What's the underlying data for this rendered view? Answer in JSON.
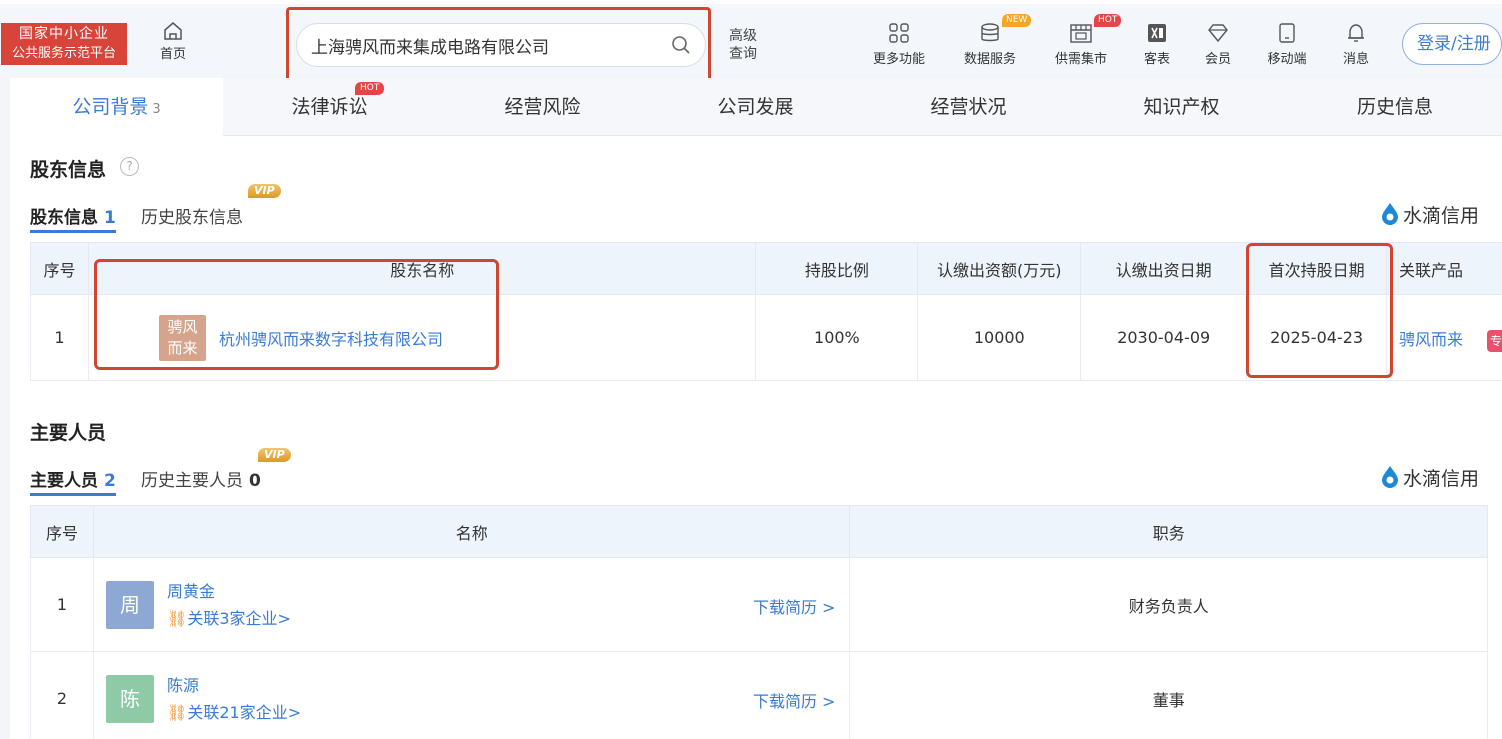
{
  "header": {
    "logo_line1": "国家中小企业",
    "logo_line2": "公共服务示范平台",
    "home_label": "首页",
    "search_value": "上海骋风而来集成电路有限公司",
    "advanced_line1": "高级",
    "advanced_line2": "查询",
    "nav": [
      {
        "label": "更多功能",
        "icon": "grid-icon"
      },
      {
        "label": "数据服务",
        "icon": "database-icon",
        "badge": "NEW"
      },
      {
        "label": "供需集市",
        "icon": "market-icon",
        "badge": "HOT"
      },
      {
        "label": "客表",
        "icon": "excel-icon"
      },
      {
        "label": "会员",
        "icon": "diamond-icon"
      },
      {
        "label": "移动端",
        "icon": "mobile-icon"
      },
      {
        "label": "消息",
        "icon": "bell-icon"
      }
    ],
    "login_label": "登录/注册"
  },
  "tabs": [
    {
      "label": "公司背景",
      "count": "3",
      "active": true
    },
    {
      "label": "法律诉讼",
      "badge": "HOT"
    },
    {
      "label": "经营风险"
    },
    {
      "label": "公司发展"
    },
    {
      "label": "经营状况"
    },
    {
      "label": "知识产权"
    },
    {
      "label": "历史信息"
    }
  ],
  "shareholders": {
    "title": "股东信息",
    "subtab_active": "股东信息",
    "subtab_active_count": "1",
    "subtab_history": "历史股东信息",
    "vip": "VIP",
    "brand": "水滴信用",
    "headers": [
      "序号",
      "股东名称",
      "持股比例",
      "认缴出资额(万元)",
      "认缴出资日期",
      "首次持股日期",
      "关联产品"
    ],
    "rows": [
      {
        "index": "1",
        "avatar_line1": "骋风",
        "avatar_line2": "而来",
        "name": "杭州骋风而来数字科技有限公司",
        "ratio": "100%",
        "amount": "10000",
        "subscribe_date": "2030-04-09",
        "first_date": "2025-04-23",
        "product": "骋风而来",
        "product_tag": "专"
      }
    ]
  },
  "personnel": {
    "title": "主要人员",
    "subtab_active": "主要人员",
    "subtab_active_count": "2",
    "subtab_history": "历史主要人员",
    "subtab_history_count": "0",
    "vip": "VIP",
    "brand": "水滴信用",
    "headers": [
      "序号",
      "名称",
      "职务"
    ],
    "download_label": "下载简历 >",
    "rows": [
      {
        "index": "1",
        "avatar": "周",
        "avatar_color": "#8ea8d4",
        "name": "周黄金",
        "related": "关联3家企业>",
        "position": "财务负责人"
      },
      {
        "index": "2",
        "avatar": "陈",
        "avatar_color": "#8ecaa6",
        "name": "陈源",
        "related": "关联21家企业>",
        "position": "董事"
      }
    ]
  },
  "colors": {
    "accent": "#3a7bd5",
    "highlight": "#d04632",
    "logo_bg": "#d8443a"
  }
}
